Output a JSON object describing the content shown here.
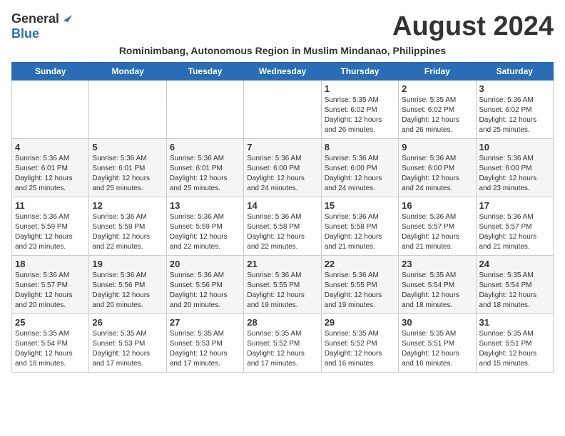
{
  "logo": {
    "general": "General",
    "blue": "Blue"
  },
  "title": "August 2024",
  "subtitle": "Rominimbang, Autonomous Region in Muslim Mindanao, Philippines",
  "days_of_week": [
    "Sunday",
    "Monday",
    "Tuesday",
    "Wednesday",
    "Thursday",
    "Friday",
    "Saturday"
  ],
  "weeks": [
    [
      {
        "date": "",
        "sunrise": "",
        "sunset": "",
        "daylight": ""
      },
      {
        "date": "",
        "sunrise": "",
        "sunset": "",
        "daylight": ""
      },
      {
        "date": "",
        "sunrise": "",
        "sunset": "",
        "daylight": ""
      },
      {
        "date": "",
        "sunrise": "",
        "sunset": "",
        "daylight": ""
      },
      {
        "date": "1",
        "sunrise": "Sunrise: 5:35 AM",
        "sunset": "Sunset: 6:02 PM",
        "daylight": "Daylight: 12 hours and 26 minutes."
      },
      {
        "date": "2",
        "sunrise": "Sunrise: 5:35 AM",
        "sunset": "Sunset: 6:02 PM",
        "daylight": "Daylight: 12 hours and 26 minutes."
      },
      {
        "date": "3",
        "sunrise": "Sunrise: 5:36 AM",
        "sunset": "Sunset: 6:02 PM",
        "daylight": "Daylight: 12 hours and 25 minutes."
      }
    ],
    [
      {
        "date": "4",
        "sunrise": "Sunrise: 5:36 AM",
        "sunset": "Sunset: 6:01 PM",
        "daylight": "Daylight: 12 hours and 25 minutes."
      },
      {
        "date": "5",
        "sunrise": "Sunrise: 5:36 AM",
        "sunset": "Sunset: 6:01 PM",
        "daylight": "Daylight: 12 hours and 25 minutes."
      },
      {
        "date": "6",
        "sunrise": "Sunrise: 5:36 AM",
        "sunset": "Sunset: 6:01 PM",
        "daylight": "Daylight: 12 hours and 25 minutes."
      },
      {
        "date": "7",
        "sunrise": "Sunrise: 5:36 AM",
        "sunset": "Sunset: 6:00 PM",
        "daylight": "Daylight: 12 hours and 24 minutes."
      },
      {
        "date": "8",
        "sunrise": "Sunrise: 5:36 AM",
        "sunset": "Sunset: 6:00 PM",
        "daylight": "Daylight: 12 hours and 24 minutes."
      },
      {
        "date": "9",
        "sunrise": "Sunrise: 5:36 AM",
        "sunset": "Sunset: 6:00 PM",
        "daylight": "Daylight: 12 hours and 24 minutes."
      },
      {
        "date": "10",
        "sunrise": "Sunrise: 5:36 AM",
        "sunset": "Sunset: 6:00 PM",
        "daylight": "Daylight: 12 hours and 23 minutes."
      }
    ],
    [
      {
        "date": "11",
        "sunrise": "Sunrise: 5:36 AM",
        "sunset": "Sunset: 5:59 PM",
        "daylight": "Daylight: 12 hours and 23 minutes."
      },
      {
        "date": "12",
        "sunrise": "Sunrise: 5:36 AM",
        "sunset": "Sunset: 5:59 PM",
        "daylight": "Daylight: 12 hours and 22 minutes."
      },
      {
        "date": "13",
        "sunrise": "Sunrise: 5:36 AM",
        "sunset": "Sunset: 5:59 PM",
        "daylight": "Daylight: 12 hours and 22 minutes."
      },
      {
        "date": "14",
        "sunrise": "Sunrise: 5:36 AM",
        "sunset": "Sunset: 5:58 PM",
        "daylight": "Daylight: 12 hours and 22 minutes."
      },
      {
        "date": "15",
        "sunrise": "Sunrise: 5:36 AM",
        "sunset": "Sunset: 5:58 PM",
        "daylight": "Daylight: 12 hours and 21 minutes."
      },
      {
        "date": "16",
        "sunrise": "Sunrise: 5:36 AM",
        "sunset": "Sunset: 5:57 PM",
        "daylight": "Daylight: 12 hours and 21 minutes."
      },
      {
        "date": "17",
        "sunrise": "Sunrise: 5:36 AM",
        "sunset": "Sunset: 5:57 PM",
        "daylight": "Daylight: 12 hours and 21 minutes."
      }
    ],
    [
      {
        "date": "18",
        "sunrise": "Sunrise: 5:36 AM",
        "sunset": "Sunset: 5:57 PM",
        "daylight": "Daylight: 12 hours and 20 minutes."
      },
      {
        "date": "19",
        "sunrise": "Sunrise: 5:36 AM",
        "sunset": "Sunset: 5:56 PM",
        "daylight": "Daylight: 12 hours and 20 minutes."
      },
      {
        "date": "20",
        "sunrise": "Sunrise: 5:36 AM",
        "sunset": "Sunset: 5:56 PM",
        "daylight": "Daylight: 12 hours and 20 minutes."
      },
      {
        "date": "21",
        "sunrise": "Sunrise: 5:36 AM",
        "sunset": "Sunset: 5:55 PM",
        "daylight": "Daylight: 12 hours and 19 minutes."
      },
      {
        "date": "22",
        "sunrise": "Sunrise: 5:36 AM",
        "sunset": "Sunset: 5:55 PM",
        "daylight": "Daylight: 12 hours and 19 minutes."
      },
      {
        "date": "23",
        "sunrise": "Sunrise: 5:35 AM",
        "sunset": "Sunset: 5:54 PM",
        "daylight": "Daylight: 12 hours and 18 minutes."
      },
      {
        "date": "24",
        "sunrise": "Sunrise: 5:35 AM",
        "sunset": "Sunset: 5:54 PM",
        "daylight": "Daylight: 12 hours and 18 minutes."
      }
    ],
    [
      {
        "date": "25",
        "sunrise": "Sunrise: 5:35 AM",
        "sunset": "Sunset: 5:54 PM",
        "daylight": "Daylight: 12 hours and 18 minutes."
      },
      {
        "date": "26",
        "sunrise": "Sunrise: 5:35 AM",
        "sunset": "Sunset: 5:53 PM",
        "daylight": "Daylight: 12 hours and 17 minutes."
      },
      {
        "date": "27",
        "sunrise": "Sunrise: 5:35 AM",
        "sunset": "Sunset: 5:53 PM",
        "daylight": "Daylight: 12 hours and 17 minutes."
      },
      {
        "date": "28",
        "sunrise": "Sunrise: 5:35 AM",
        "sunset": "Sunset: 5:52 PM",
        "daylight": "Daylight: 12 hours and 17 minutes."
      },
      {
        "date": "29",
        "sunrise": "Sunrise: 5:35 AM",
        "sunset": "Sunset: 5:52 PM",
        "daylight": "Daylight: 12 hours and 16 minutes."
      },
      {
        "date": "30",
        "sunrise": "Sunrise: 5:35 AM",
        "sunset": "Sunset: 5:51 PM",
        "daylight": "Daylight: 12 hours and 16 minutes."
      },
      {
        "date": "31",
        "sunrise": "Sunrise: 5:35 AM",
        "sunset": "Sunset: 5:51 PM",
        "daylight": "Daylight: 12 hours and 15 minutes."
      }
    ]
  ]
}
